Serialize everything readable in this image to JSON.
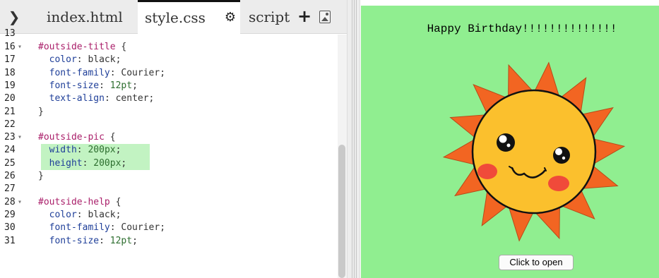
{
  "tabs": {
    "collapse_icon": "chevron-right-icon",
    "index": "index.html",
    "style": "style.css",
    "script": "script",
    "add": "+",
    "settings_icon": "gear-icon",
    "image_icon": "image-icon"
  },
  "code": {
    "lines": [
      {
        "n": "13",
        "parts": []
      },
      {
        "n": "16",
        "fold": true,
        "parts": [
          [
            "sel",
            "#outside-title"
          ],
          [
            "txt",
            " {"
          ]
        ]
      },
      {
        "n": "17",
        "parts": [
          [
            "txt",
            "  "
          ],
          [
            "prop",
            "color"
          ],
          [
            "txt",
            ": black;"
          ]
        ]
      },
      {
        "n": "18",
        "parts": [
          [
            "txt",
            "  "
          ],
          [
            "prop",
            "font-family"
          ],
          [
            "txt",
            ": Courier;"
          ]
        ]
      },
      {
        "n": "19",
        "parts": [
          [
            "txt",
            "  "
          ],
          [
            "prop",
            "font-size"
          ],
          [
            "txt",
            ": "
          ],
          [
            "num",
            "12"
          ],
          [
            "unit",
            "pt"
          ],
          [
            "txt",
            ";"
          ]
        ]
      },
      {
        "n": "20",
        "parts": [
          [
            "txt",
            "  "
          ],
          [
            "prop",
            "text-align"
          ],
          [
            "txt",
            ": center;"
          ]
        ]
      },
      {
        "n": "21",
        "parts": [
          [
            "txt",
            "}"
          ]
        ]
      },
      {
        "n": "22",
        "parts": []
      },
      {
        "n": "23",
        "fold": true,
        "parts": [
          [
            "sel",
            "#outside-pic"
          ],
          [
            "txt",
            " {"
          ]
        ]
      },
      {
        "n": "24",
        "hl": true,
        "parts": [
          [
            "txt",
            "  "
          ],
          [
            "prop",
            "width"
          ],
          [
            "txt",
            ": "
          ],
          [
            "num",
            "200"
          ],
          [
            "unit",
            "px"
          ],
          [
            "txt",
            ";"
          ]
        ]
      },
      {
        "n": "25",
        "hl": true,
        "parts": [
          [
            "txt",
            "  "
          ],
          [
            "prop",
            "height"
          ],
          [
            "txt",
            ": "
          ],
          [
            "num",
            "200"
          ],
          [
            "unit",
            "px"
          ],
          [
            "txt",
            ";"
          ]
        ]
      },
      {
        "n": "26",
        "parts": [
          [
            "txt",
            "}"
          ]
        ]
      },
      {
        "n": "27",
        "parts": []
      },
      {
        "n": "28",
        "fold": true,
        "parts": [
          [
            "sel",
            "#outside-help"
          ],
          [
            "txt",
            " {"
          ]
        ]
      },
      {
        "n": "29",
        "parts": [
          [
            "txt",
            "  "
          ],
          [
            "prop",
            "color"
          ],
          [
            "txt",
            ": black;"
          ]
        ]
      },
      {
        "n": "30",
        "parts": [
          [
            "txt",
            "  "
          ],
          [
            "prop",
            "font-family"
          ],
          [
            "txt",
            ": Courier;"
          ]
        ]
      },
      {
        "n": "31",
        "parts": [
          [
            "txt",
            "  "
          ],
          [
            "prop",
            "font-size"
          ],
          [
            "txt",
            ": "
          ],
          [
            "num",
            "12"
          ],
          [
            "unit",
            "pt"
          ],
          [
            "txt",
            ";"
          ]
        ]
      }
    ]
  },
  "preview": {
    "title": "Happy Birthday!!!!!!!!!!!!!!",
    "image_icon": "smiling-sun-icon",
    "button": "Click to open",
    "background": "#90ee90"
  },
  "colors": {
    "selector": "#aa1f6a",
    "property": "#1f3f99",
    "number": "#2d6e2f",
    "highlight": "#c2f3c2",
    "sun_rays": "#f26522",
    "sun_face": "#fbc02d",
    "cheeks": "#f04a3a"
  }
}
